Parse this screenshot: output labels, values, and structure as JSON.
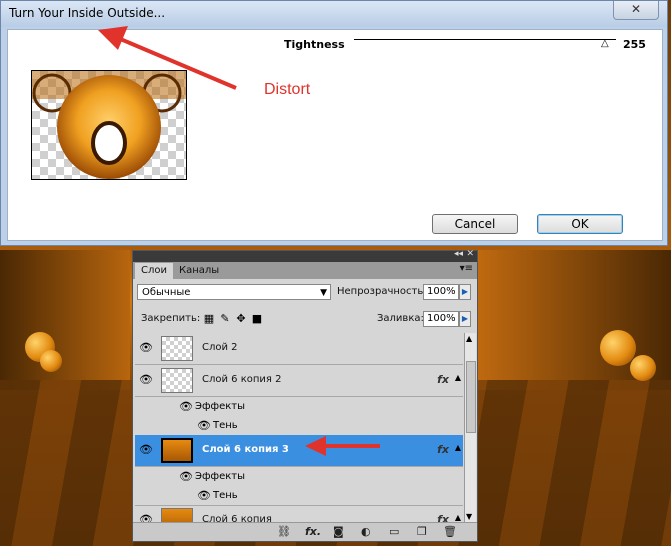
{
  "dialog": {
    "title": "Turn Your Inside Outside...",
    "close_label": "✕",
    "tightness_label": "Tightness",
    "tightness_value": "255",
    "tightness_level": 1.0,
    "annotation": "Distort",
    "cancel_label": "Cancel",
    "ok_label": "OK"
  },
  "panel": {
    "tabs": [
      "Слои",
      "Каналы"
    ],
    "menu_icon": "panel-menu-icon",
    "blend_mode": "Обычные",
    "opacity_label": "Непрозрачность:",
    "opacity_value": "100%",
    "lock_label": "Закрепить:",
    "fill_label": "Заливка:",
    "fill_value": "100%",
    "layers": [
      {
        "name": "Слой 2"
      },
      {
        "name": "Слой 6 копия 2",
        "fx": "fx"
      },
      {
        "name": "Слой 6 копия 3",
        "fx": "fx"
      },
      {
        "name": "Слой 6 копия",
        "fx": "fx"
      }
    ],
    "effects_label": "Эффекты",
    "shadow_label": "Тень"
  },
  "colors": {
    "selection": "#3b8fe0",
    "annotation_red": "#e0332b"
  }
}
